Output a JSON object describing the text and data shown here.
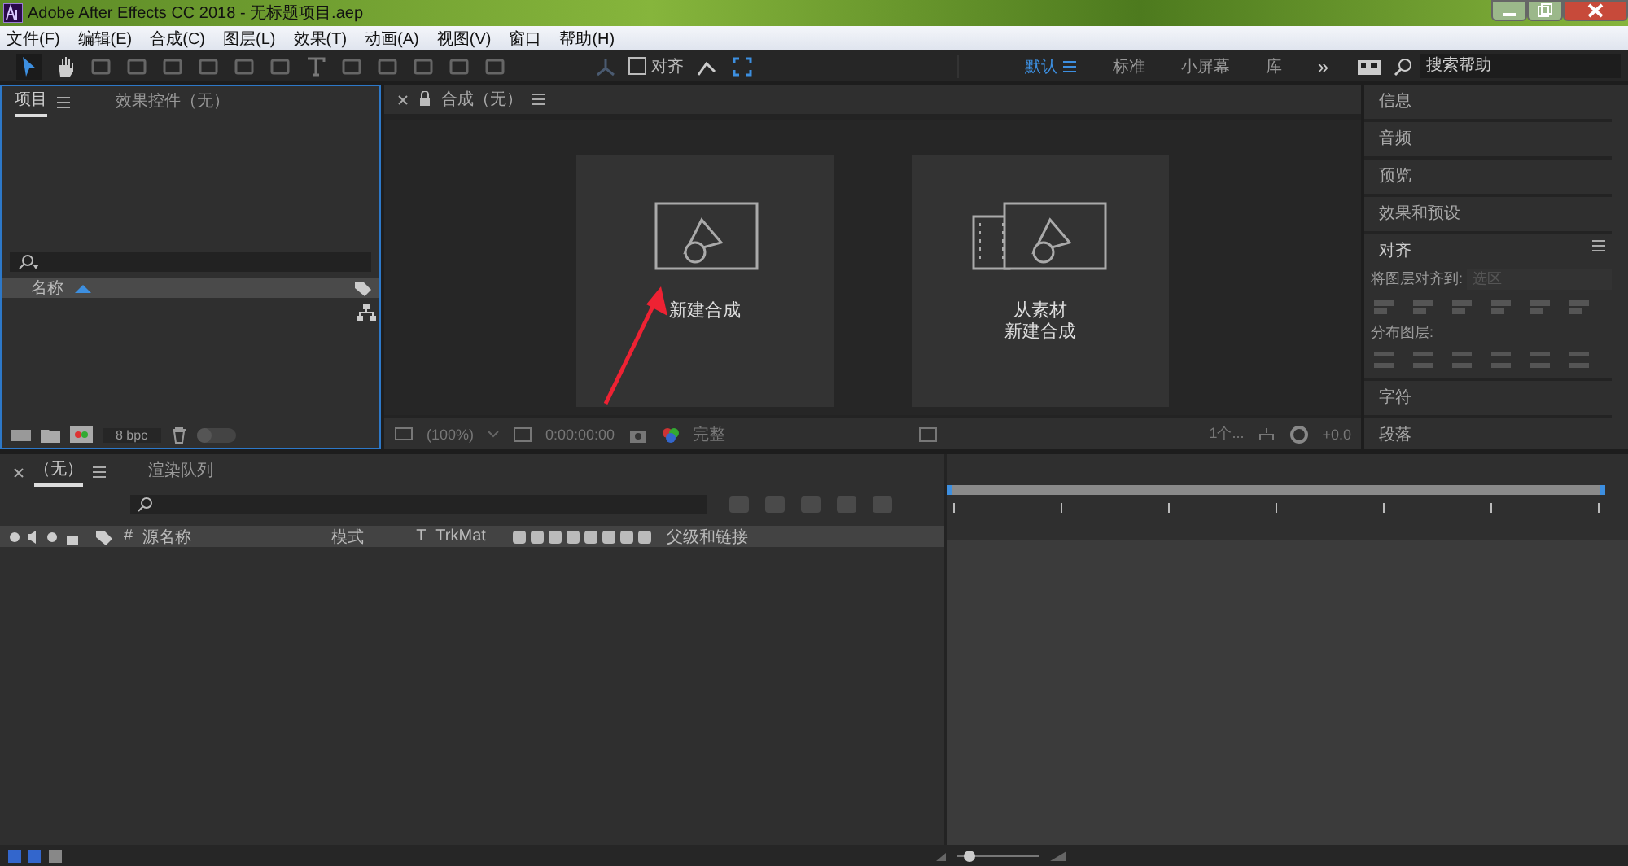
{
  "window": {
    "title": "Adobe After Effects CC 2018 - 无标题项目.aep"
  },
  "menu": [
    "文件(F)",
    "编辑(E)",
    "合成(C)",
    "图层(L)",
    "效果(T)",
    "动画(A)",
    "视图(V)",
    "窗口",
    "帮助(H)"
  ],
  "toolbar": {
    "snap": {
      "label": "对齐",
      "checked": false
    },
    "workspaces": [
      {
        "label": "默认",
        "selected": true
      },
      {
        "label": "标准",
        "selected": false
      },
      {
        "label": "小屏幕",
        "selected": false
      },
      {
        "label": "库",
        "selected": false
      }
    ],
    "more": "»",
    "search": {
      "placeholder": "搜索帮助"
    }
  },
  "project_panel": {
    "tabs": [
      {
        "label": "项目",
        "selected": true
      },
      {
        "label": "效果控件（无）",
        "selected": false
      }
    ],
    "column": "名称",
    "bpc": "8 bpc",
    "thumbnail_slider": {
      "level": 0.0
    }
  },
  "composition_panel": {
    "tab": "合成（无）",
    "cards": [
      {
        "kind": "new",
        "lines": [
          "新建合成"
        ]
      },
      {
        "kind": "footage",
        "lines": [
          "从素材",
          "新建合成"
        ]
      }
    ],
    "footer": {
      "zoom": "(100%)",
      "time": "0:00:00:00",
      "resolution": "完整",
      "views": "1个...",
      "exposure": "+0.0"
    }
  },
  "right_panels": {
    "top": [
      "信息",
      "音频",
      "预览",
      "效果和预设"
    ],
    "align": {
      "title": "对齐",
      "align_to_label": "将图层对齐到:",
      "align_to_value": "选区",
      "distribute_label": "分布图层:"
    },
    "bottom": [
      "字符",
      "段落"
    ]
  },
  "timeline": {
    "tabs": [
      {
        "label": "（无）",
        "selected": true
      },
      {
        "label": "渲染队列",
        "selected": false
      }
    ],
    "columns": [
      "#",
      "源名称",
      "模式",
      "T",
      "TrkMat",
      "父级和链接"
    ],
    "zoom_slider": {
      "level": 0.15
    }
  },
  "annotation": {
    "kind": "arrow"
  }
}
